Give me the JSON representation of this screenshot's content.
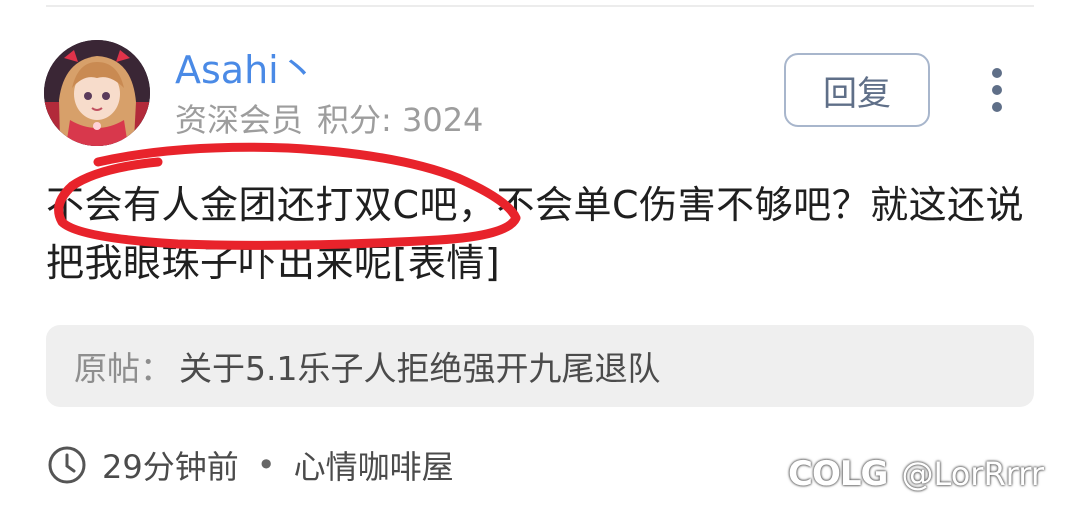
{
  "post": {
    "user": {
      "name": "Asahi丶",
      "level": "资深会员",
      "points": "积分: 3024"
    },
    "reply_label": "回复",
    "content": "不会有人金团还打双C吧，不会单C伤害不够吧？就这还说把我眼珠子吓出来呢[表情]",
    "quote": {
      "label": "原帖：",
      "title": "关于5.1乐子人拒绝强开九尾退队"
    },
    "time_ago": "29分钟前",
    "separator": "•",
    "board": "心情咖啡屋"
  },
  "watermark": {
    "logo": "COLG",
    "handle": "@LorRrrr"
  },
  "colors": {
    "username": "#4a8ae6",
    "highlight_scribble": "#e8232b",
    "reply_border": "#a8b6cc"
  },
  "icons": {
    "more": "more-vertical-icon",
    "time": "clock-icon"
  }
}
